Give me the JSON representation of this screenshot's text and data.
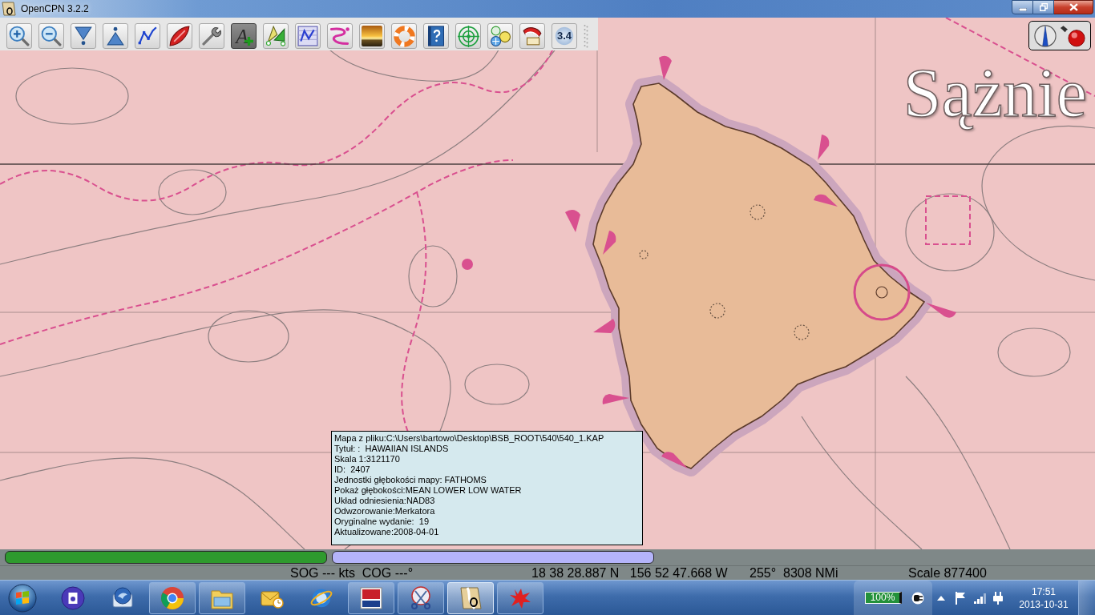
{
  "window": {
    "title": "OpenCPN 3.2.2"
  },
  "toolbar": {
    "buttons": [
      {
        "kind": "zoomin",
        "selected": false
      },
      {
        "kind": "zoomout",
        "selected": false
      },
      {
        "kind": "scaledown",
        "selected": false
      },
      {
        "kind": "scaleup",
        "selected": false
      },
      {
        "kind": "route",
        "selected": false
      },
      {
        "kind": "ownship",
        "selected": false
      },
      {
        "kind": "settings",
        "selected": false
      },
      {
        "kind": "text",
        "label": "A",
        "selected": true
      },
      {
        "kind": "tides",
        "selected": false
      },
      {
        "kind": "routes",
        "selected": false
      },
      {
        "kind": "track",
        "selected": false
      },
      {
        "kind": "colors",
        "selected": false
      },
      {
        "kind": "mob",
        "selected": false
      },
      {
        "kind": "help",
        "selected": false
      },
      {
        "kind": "radar",
        "selected": false
      },
      {
        "kind": "dashboard",
        "selected": false
      },
      {
        "kind": "plugin",
        "selected": false
      },
      {
        "kind": "about",
        "label": "3.4",
        "selected": false
      }
    ]
  },
  "depth_units": "Sążnie",
  "chart_info": [
    "Mapa z pliku:C:\\Users\\bartowo\\Desktop\\BSB_ROOT\\540\\540_1.KAP",
    "Tytuł: :  HAWAIIAN ISLANDS",
    "Skala 1:3121170",
    "ID:  2407",
    "Jednostki głębokości mapy: FATHOMS",
    "Pokaż głębokości:MEAN LOWER LOW WATER",
    "Układ odniesienia:NAD83",
    "Odwzorowanie:Merkatora",
    "Oryginalne wydanie:  19",
    "Aktualizowane:2008-04-01"
  ],
  "chart_bar": {
    "keys": [
      {
        "color": "#2e9a2e"
      },
      {
        "color": "#b4b4fa"
      }
    ]
  },
  "status_bar": {
    "sog_cog": "SOG --- kts  COG ---°",
    "cursor_position": "18 38 28.887 N   156 52 47.668 W",
    "bearing_range": "255°  8308 NMi",
    "scale": "Scale 877400"
  },
  "taskbar": {
    "buttons": [
      {
        "kind": "disc",
        "running": false,
        "selected": false
      },
      {
        "kind": "mail",
        "running": false,
        "selected": false
      },
      {
        "kind": "browser",
        "running": true,
        "selected": false
      },
      {
        "kind": "folder",
        "running": true,
        "selected": false
      },
      {
        "kind": "envelope",
        "running": false,
        "selected": false
      },
      {
        "kind": "internet",
        "running": false,
        "selected": false
      },
      {
        "kind": "tile",
        "running": true,
        "selected": false
      },
      {
        "kind": "scissors",
        "running": true,
        "selected": false
      },
      {
        "kind": "chart",
        "running": true,
        "selected": true
      },
      {
        "kind": "splat",
        "running": true,
        "selected": false
      }
    ]
  },
  "tray": {
    "battery": "100%",
    "time": "17:51",
    "date": "2013-10-31"
  }
}
